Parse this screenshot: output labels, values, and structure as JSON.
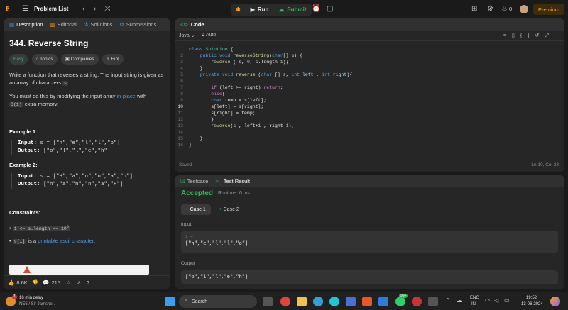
{
  "topbar": {
    "problem_list": "Problem List",
    "run": "Run",
    "submit": "Submit",
    "streak": "0",
    "premium": "Premium"
  },
  "left_tabs": [
    "Description",
    "Editorial",
    "Solutions",
    "Submissions"
  ],
  "problem": {
    "title": "344. Reverse String",
    "tags": [
      "Easy",
      "Topics",
      "Companies",
      "Hint"
    ],
    "p1a": "Write a function that reverses a string. The input string is given as an array of characters ",
    "p1code": "s",
    "p1b": ".",
    "p2a": "You must do this by modifying the input array ",
    "p2link": "in-place",
    "p2b": " with ",
    "p2code": "O(1)",
    "p2c": " extra memory.",
    "ex1_title": "Example 1:",
    "ex1_in_label": "Input:",
    "ex1_in": "s = [\"h\",\"e\",\"l\",\"l\",\"o\"]",
    "ex1_out_label": "Output:",
    "ex1_out": "[\"o\",\"l\",\"l\",\"e\",\"h\"]",
    "ex2_title": "Example 2:",
    "ex2_in_label": "Input:",
    "ex2_in": "s = [\"H\",\"a\",\"n\",\"n\",\"a\",\"h\"]",
    "ex2_out_label": "Output:",
    "ex2_out": "[\"h\",\"a\",\"n\",\"n\",\"a\",\"H\"]",
    "constraints_title": "Constraints:",
    "c1": "1 <= s.length <= 10",
    "c1_sup": "5",
    "c2code": "s[i]",
    "c2a": " is a ",
    "c2link": "printable ascii character",
    "c2b": ".",
    "likes": "8.6K",
    "comments": "215"
  },
  "code": {
    "title": "Code",
    "lang": "Java",
    "auto": "Auto",
    "saved": "Saved",
    "cursor": "Ln 10, Col 28",
    "lines": [
      "1",
      "2",
      "3",
      "4",
      "5",
      "6",
      "7",
      "8",
      "9",
      "10",
      "11",
      "12",
      "13",
      "14",
      "15",
      "16"
    ]
  },
  "testcase": {
    "tab1": "Testcase",
    "tab2": "Test Result",
    "status": "Accepted",
    "runtime": "Runtime: 0 ms",
    "case1": "Case 1",
    "case2": "Case 2",
    "input_label": "Input",
    "var": "s =",
    "input_val": "[\"h\",\"e\",\"l\",\"l\",\"o\"]",
    "output_label": "Output",
    "output_val": "[\"o\",\"l\",\"l\",\"e\",\"h\"]"
  },
  "taskbar": {
    "notif": "1",
    "weather1": "16 min delay",
    "weather2": "NE5 / Sir Jamshe...",
    "search": "Search",
    "lang1": "ENG",
    "lang2": "IN",
    "time": "19:52",
    "date": "13-06-2024",
    "badge": "99+"
  }
}
